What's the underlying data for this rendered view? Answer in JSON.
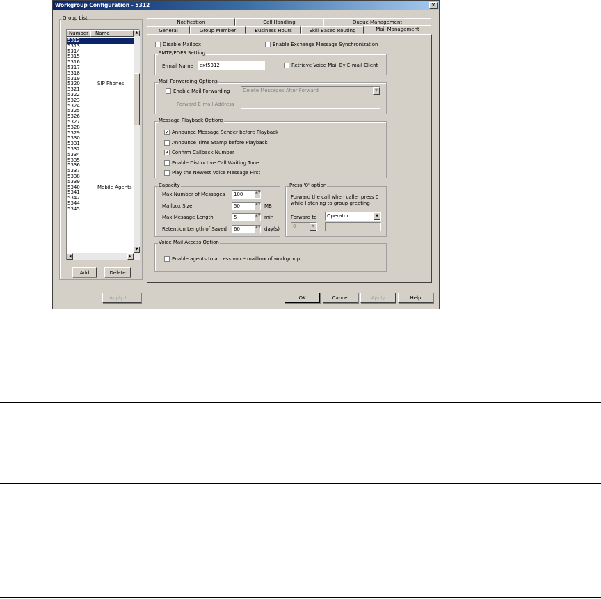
{
  "window": {
    "title": "Workgroup Configuration - 5312",
    "close_label": "✕"
  },
  "group_list": {
    "legend": "Group List",
    "col_number": "Number",
    "col_name": "Name",
    "rows": [
      {
        "number": "5312",
        "name": ""
      },
      {
        "number": "5313",
        "name": ""
      },
      {
        "number": "5314",
        "name": ""
      },
      {
        "number": "5315",
        "name": ""
      },
      {
        "number": "5316",
        "name": ""
      },
      {
        "number": "5317",
        "name": ""
      },
      {
        "number": "5318",
        "name": ""
      },
      {
        "number": "5319",
        "name": ""
      },
      {
        "number": "5320",
        "name": "SIP Phones"
      },
      {
        "number": "5321",
        "name": ""
      },
      {
        "number": "5322",
        "name": ""
      },
      {
        "number": "5323",
        "name": ""
      },
      {
        "number": "5324",
        "name": ""
      },
      {
        "number": "5325",
        "name": ""
      },
      {
        "number": "5326",
        "name": ""
      },
      {
        "number": "5327",
        "name": ""
      },
      {
        "number": "5328",
        "name": ""
      },
      {
        "number": "5329",
        "name": ""
      },
      {
        "number": "5330",
        "name": ""
      },
      {
        "number": "5331",
        "name": ""
      },
      {
        "number": "5332",
        "name": ""
      },
      {
        "number": "5334",
        "name": ""
      },
      {
        "number": "5335",
        "name": ""
      },
      {
        "number": "5336",
        "name": ""
      },
      {
        "number": "5337",
        "name": ""
      },
      {
        "number": "5338",
        "name": ""
      },
      {
        "number": "5339",
        "name": ""
      },
      {
        "number": "5340",
        "name": "Mobile Agents"
      },
      {
        "number": "5341",
        "name": ""
      },
      {
        "number": "5342",
        "name": ""
      },
      {
        "number": "5344",
        "name": ""
      },
      {
        "number": "5345",
        "name": ""
      }
    ],
    "add_label": "Add",
    "delete_label": "Delete"
  },
  "tabs_top": [
    "Notification",
    "Call Handling",
    "Queue Management"
  ],
  "tabs_bottom": [
    "General",
    "Group Member",
    "Business Hours",
    "Skill Based Routing",
    "Mail Management"
  ],
  "mail": {
    "disable_mailbox": "Disable Mailbox",
    "enable_exchange": "Enable Exchange Message Synchronization",
    "smtp_legend": "SMTP/POP3 Setting",
    "email_name_label": "E-mail Name",
    "email_name_value": "ext5312",
    "retrieve_label": "Retrieve Voice Mail By E-mail Client",
    "fwd_legend": "Mail Forwarding Options",
    "enable_fwd": "Enable Mail Forwarding",
    "fwd_mode": "Delete Messages After Forward",
    "fwd_addr_label": "Forward E-mail Address",
    "playback_legend": "Message Playback Options",
    "playback": [
      {
        "label": "Announce Message Sender before Playback",
        "checked": "✔"
      },
      {
        "label": "Announce Time Stamp before Playback",
        "checked": ""
      },
      {
        "label": "Confirm Callback Number",
        "checked": "✔"
      },
      {
        "label": "Enable Distinctive Call Waiting Tone",
        "checked": ""
      },
      {
        "label": "Play the Newest Voice Message First",
        "checked": ""
      }
    ],
    "capacity_legend": "Capacity",
    "capacity": [
      {
        "label": "Max Number of Messages",
        "value": "100",
        "unit": ""
      },
      {
        "label": "Mailbox Size",
        "value": "50",
        "unit": "MB"
      },
      {
        "label": "Max Message Length",
        "value": "5",
        "unit": "min"
      },
      {
        "label": "Retention Length of Saved",
        "value": "60",
        "unit": "day(s)"
      }
    ],
    "press0_legend": "Press '0' option",
    "press0_desc1": "Forward the call when caller press 0",
    "press0_desc2": "while listening to group greeting",
    "forward_to_label": "Forward to",
    "forward_to_value": "Operator",
    "press0_small_value": "0",
    "vm_access_legend": "Voice Mail Access Option",
    "vm_access_label": "Enable agents to access voice mailbox of workgroup"
  },
  "buttons": {
    "apply_to": "Apply to...",
    "ok": "OK",
    "cancel": "Cancel",
    "apply": "Apply",
    "help": "Help"
  }
}
